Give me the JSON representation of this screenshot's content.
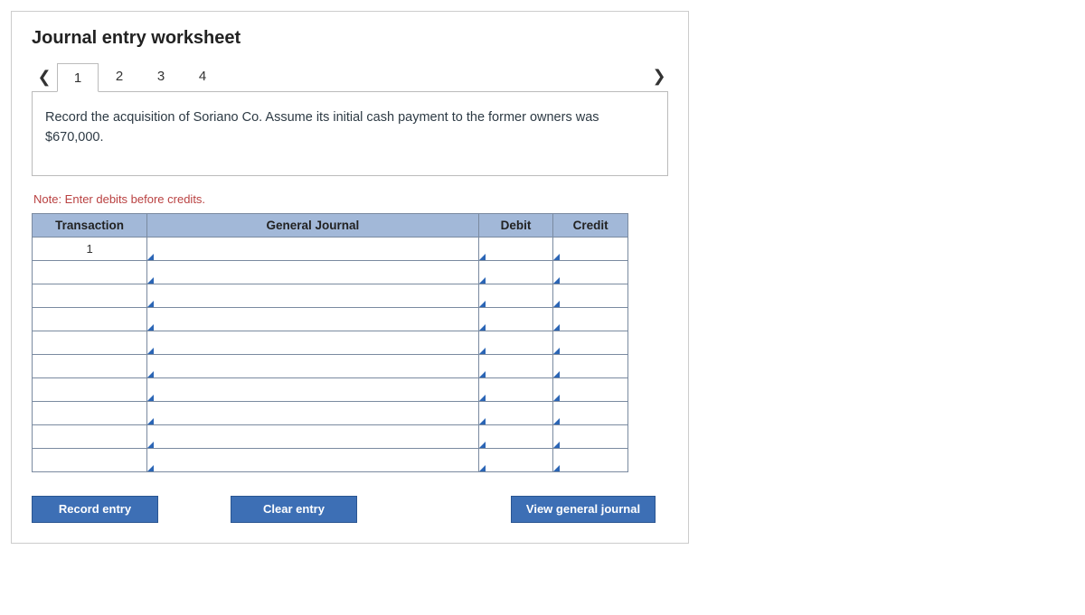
{
  "title": "Journal entry worksheet",
  "tabs": [
    "1",
    "2",
    "3",
    "4"
  ],
  "activeTab": 0,
  "instruction": "Record the acquisition of Soriano Co. Assume its initial cash payment to the former owners was $670,000.",
  "note": "Note: Enter debits before credits.",
  "table": {
    "headers": {
      "transaction": "Transaction",
      "general_journal": "General Journal",
      "debit": "Debit",
      "credit": "Credit"
    },
    "rows": [
      {
        "transaction": "1",
        "gj": "",
        "debit": "",
        "credit": ""
      },
      {
        "transaction": "",
        "gj": "",
        "debit": "",
        "credit": ""
      },
      {
        "transaction": "",
        "gj": "",
        "debit": "",
        "credit": ""
      },
      {
        "transaction": "",
        "gj": "",
        "debit": "",
        "credit": ""
      },
      {
        "transaction": "",
        "gj": "",
        "debit": "",
        "credit": ""
      },
      {
        "transaction": "",
        "gj": "",
        "debit": "",
        "credit": ""
      },
      {
        "transaction": "",
        "gj": "",
        "debit": "",
        "credit": ""
      },
      {
        "transaction": "",
        "gj": "",
        "debit": "",
        "credit": ""
      },
      {
        "transaction": "",
        "gj": "",
        "debit": "",
        "credit": ""
      },
      {
        "transaction": "",
        "gj": "",
        "debit": "",
        "credit": ""
      }
    ]
  },
  "buttons": {
    "record": "Record entry",
    "clear": "Clear entry",
    "view": "View general journal"
  }
}
